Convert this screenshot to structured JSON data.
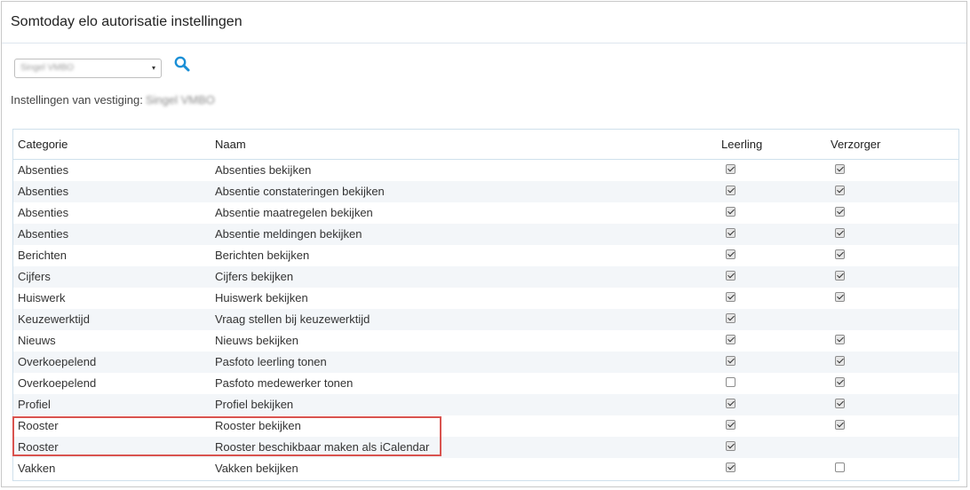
{
  "page": {
    "title": "Somtoday elo autorisatie instellingen",
    "vestiging_select": {
      "value": "Singel VMBO",
      "caret": "▾"
    },
    "vestiging_label": "Instellingen van vestiging:",
    "vestiging_name": "Singel VMBO",
    "search_icon": "search-icon",
    "accent_color": "#1a8fd6",
    "highlight_color": "#d9534f"
  },
  "table": {
    "columns": {
      "categorie": "Categorie",
      "naam": "Naam",
      "leerling": "Leerling",
      "verzorger": "Verzorger"
    },
    "rows": [
      {
        "categorie": "Absenties",
        "naam": "Absenties bekijken",
        "leerling": true,
        "verzorger": true
      },
      {
        "categorie": "Absenties",
        "naam": "Absentie constateringen bekijken",
        "leerling": true,
        "verzorger": true
      },
      {
        "categorie": "Absenties",
        "naam": "Absentie maatregelen bekijken",
        "leerling": true,
        "verzorger": true
      },
      {
        "categorie": "Absenties",
        "naam": "Absentie meldingen bekijken",
        "leerling": true,
        "verzorger": true
      },
      {
        "categorie": "Berichten",
        "naam": "Berichten bekijken",
        "leerling": true,
        "verzorger": true
      },
      {
        "categorie": "Cijfers",
        "naam": "Cijfers bekijken",
        "leerling": true,
        "verzorger": true
      },
      {
        "categorie": "Huiswerk",
        "naam": "Huiswerk bekijken",
        "leerling": true,
        "verzorger": true
      },
      {
        "categorie": "Keuzewerktijd",
        "naam": "Vraag stellen bij keuzewerktijd",
        "leerling": true,
        "verzorger": null
      },
      {
        "categorie": "Nieuws",
        "naam": "Nieuws bekijken",
        "leerling": true,
        "verzorger": true
      },
      {
        "categorie": "Overkoepelend",
        "naam": "Pasfoto leerling tonen",
        "leerling": true,
        "verzorger": true
      },
      {
        "categorie": "Overkoepelend",
        "naam": "Pasfoto medewerker tonen",
        "leerling": false,
        "verzorger": true
      },
      {
        "categorie": "Profiel",
        "naam": "Profiel bekijken",
        "leerling": true,
        "verzorger": true
      },
      {
        "categorie": "Rooster",
        "naam": "Rooster bekijken",
        "leerling": true,
        "verzorger": true
      },
      {
        "categorie": "Rooster",
        "naam": "Rooster beschikbaar maken als iCalendar",
        "leerling": true,
        "verzorger": null
      },
      {
        "categorie": "Vakken",
        "naam": "Vakken bekijken",
        "leerling": true,
        "verzorger": false
      }
    ]
  }
}
